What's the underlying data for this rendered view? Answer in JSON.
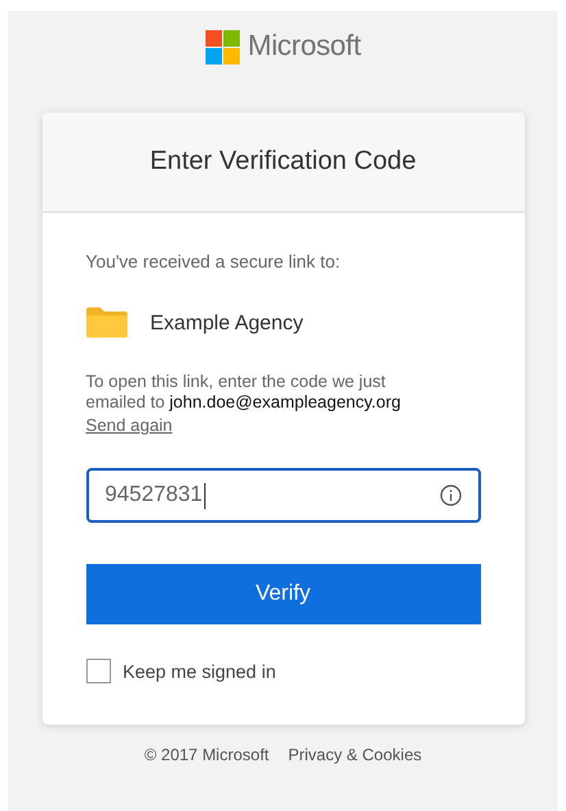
{
  "logo": {
    "text": "Microsoft"
  },
  "card": {
    "title": "Enter Verification Code",
    "intro": "You've received a secure link to:",
    "recipient": "Example Agency",
    "instructions": "To open this link, enter the code we just\nemailed to **john.doe@exampleagency.org**",
    "send_again": "Send again",
    "code_field": {
      "value": "94527831",
      "focused": true
    },
    "verify_button": "Verify",
    "keep_signed_in": {
      "label": "Keep me signed in",
      "checked": false
    }
  },
  "footer": {
    "items": [
      "© 2017 Microsoft",
      "Privacy & Cookies"
    ]
  }
}
